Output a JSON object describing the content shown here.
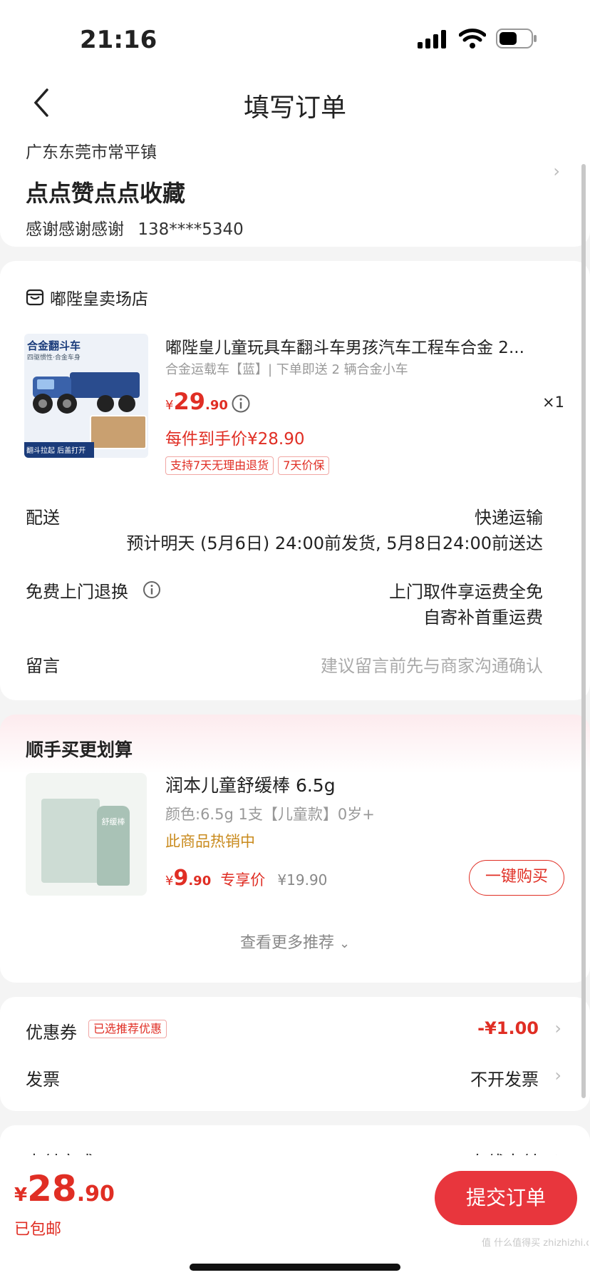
{
  "status_bar": {
    "time": "21:16"
  },
  "header": {
    "title": "填写订单"
  },
  "address": {
    "region": "广东东莞市常平镇",
    "detail": "点点赞点点收藏",
    "name": "感谢感谢感谢",
    "phone": "138****5340"
  },
  "store": {
    "name": "嘟陛皇卖场店"
  },
  "product": {
    "image_caption_top": "合金翻斗车",
    "image_caption_sub": "四驱惯性·合金车身",
    "image_caption_bottom": "翻斗拉起 后盖打开",
    "title": "嘟陛皇儿童玩具车翻斗车男孩汽车工程车合金 2...",
    "spec": "合金运载车【蓝】| 下单即送 2 辆合金小车",
    "price_symbol": "¥",
    "price_int": "29",
    "price_dec": ".90",
    "qty": "×1",
    "final_price": "每件到手价¥28.90",
    "tags": [
      "支持7天无理由退货",
      "7天价保"
    ]
  },
  "delivery": {
    "label": "配送",
    "method": "快递运输",
    "estimate": "预计明天 (5月6日) 24:00前发货, 5月8日24:00前送达"
  },
  "return_service": {
    "label": "免费上门退换",
    "line1": "上门取件享运费全免",
    "line2": "自寄补首重运费"
  },
  "message": {
    "label": "留言",
    "placeholder": "建议留言前先与商家沟通确认"
  },
  "recommend": {
    "title": "顺手买更划算",
    "item_name": "润本儿童舒缓棒 6.5g",
    "item_spec": "颜色:6.5g 1支【儿童款】0岁+",
    "item_hot": "此商品热销中",
    "price_symbol": "¥",
    "price_int": "9",
    "price_dec": ".90",
    "price_label": "专享价",
    "orig_price": "¥19.90",
    "buy_button": "一键购买",
    "pkg_text": "舒缓棒",
    "more": "查看更多推荐"
  },
  "coupon": {
    "label": "优惠券",
    "badge": "已选推荐优惠",
    "value": "-¥1.00"
  },
  "invoice": {
    "label": "发票",
    "value": "不开发票"
  },
  "payment": {
    "label": "支付方式",
    "value": "在线支付"
  },
  "footer": {
    "price_symbol": "¥",
    "price_int": "28",
    "price_dec": ".90",
    "shipping": "已包邮",
    "submit": "提交订单"
  },
  "watermark": "值 什么值得买 zhizhizhi.com"
}
